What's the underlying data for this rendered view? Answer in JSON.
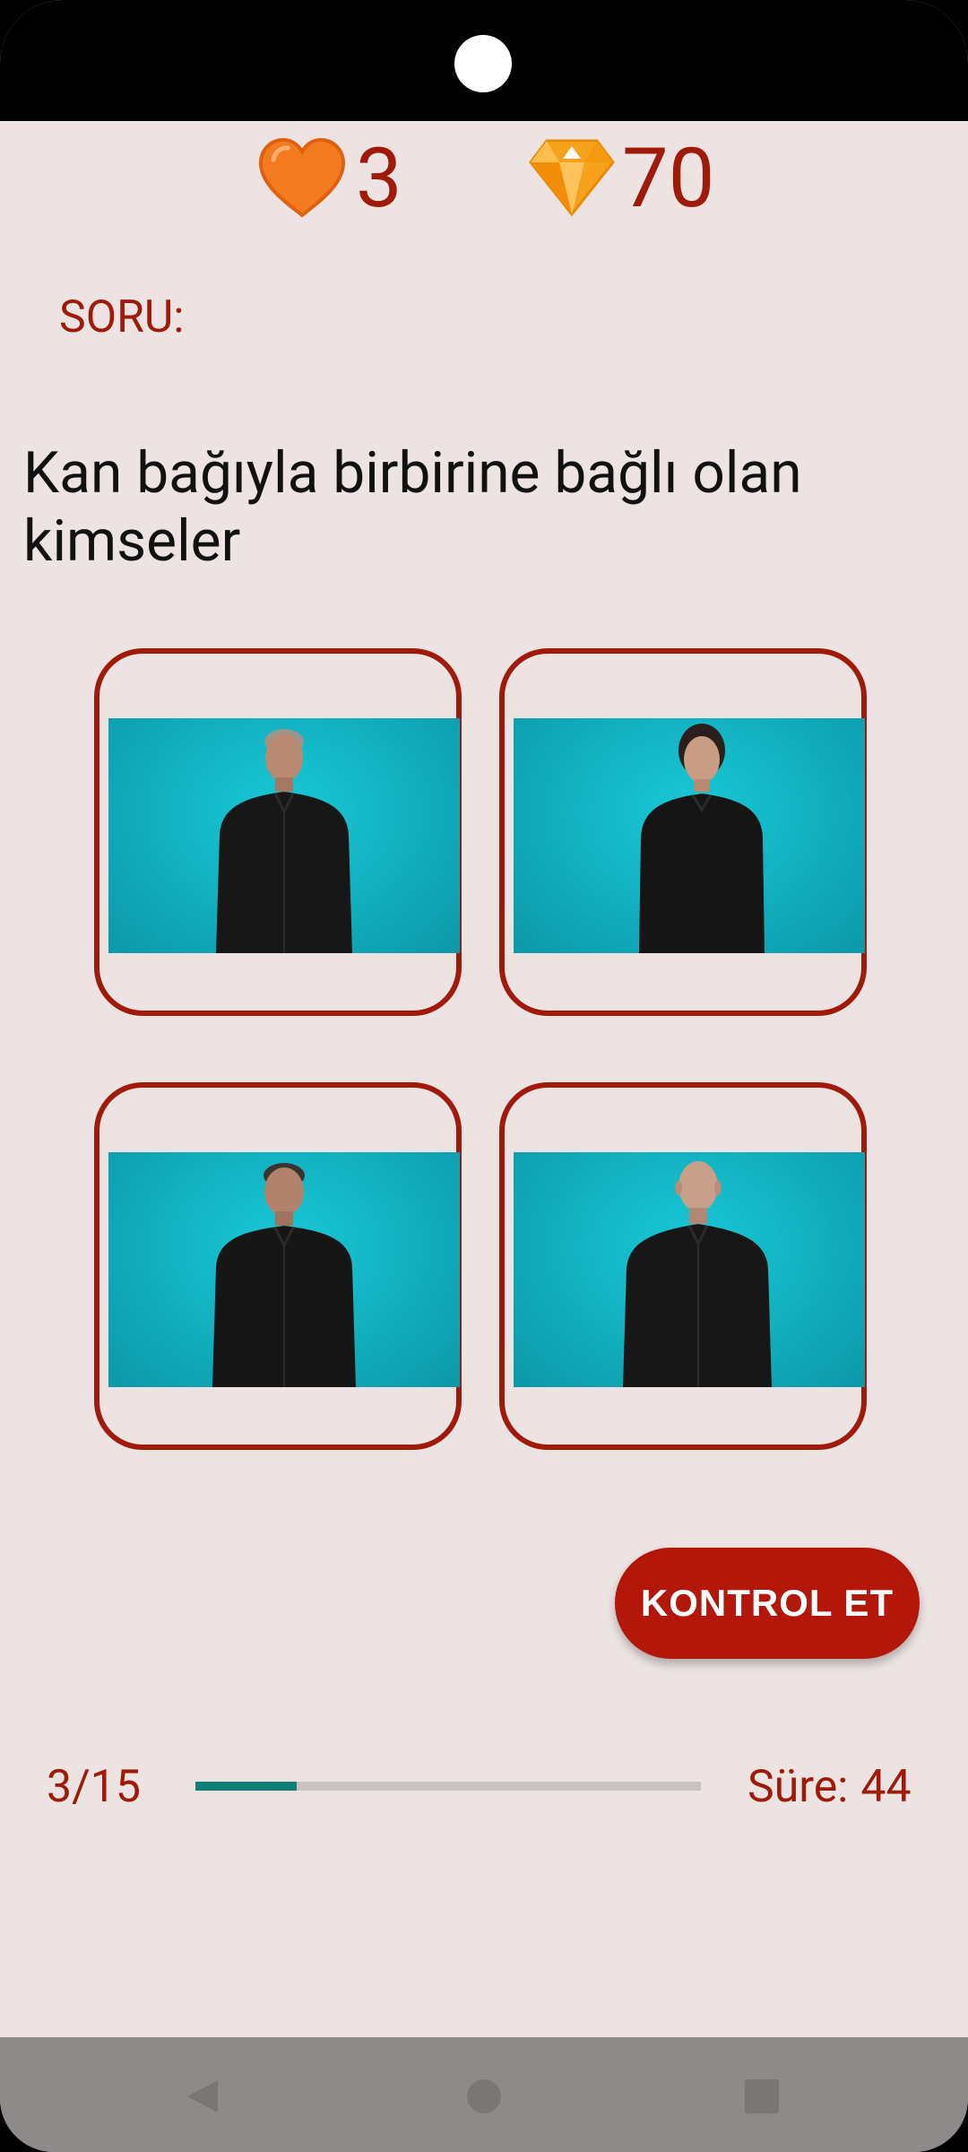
{
  "stats": {
    "hearts": "3",
    "gems": "70"
  },
  "question": {
    "label": "SORU:",
    "text": "Kan bağıyla birbirine bağlı olan kimseler"
  },
  "options": [
    {
      "name": "man-gray-hair"
    },
    {
      "name": "woman-dark-hair"
    },
    {
      "name": "man-dark-hair"
    },
    {
      "name": "man-bald"
    }
  ],
  "actions": {
    "check_label": "KONTROL ET"
  },
  "progress": {
    "label": "3/15",
    "current": 3,
    "total": 15,
    "fraction": 0.2
  },
  "timer": {
    "label": "Süre:",
    "value": "44"
  },
  "colors": {
    "accent": "#a01a0a",
    "button": "#b3170a",
    "background": "#ece3e2",
    "progress": "#0f7f74",
    "heart": "#f47a20",
    "gem": "#f6a21c"
  },
  "icons": {
    "hearts": "heart-icon",
    "gems": "diamond-icon",
    "nav_back": "back-triangle-icon",
    "nav_home": "home-circle-icon",
    "nav_recent": "recent-square-icon"
  }
}
